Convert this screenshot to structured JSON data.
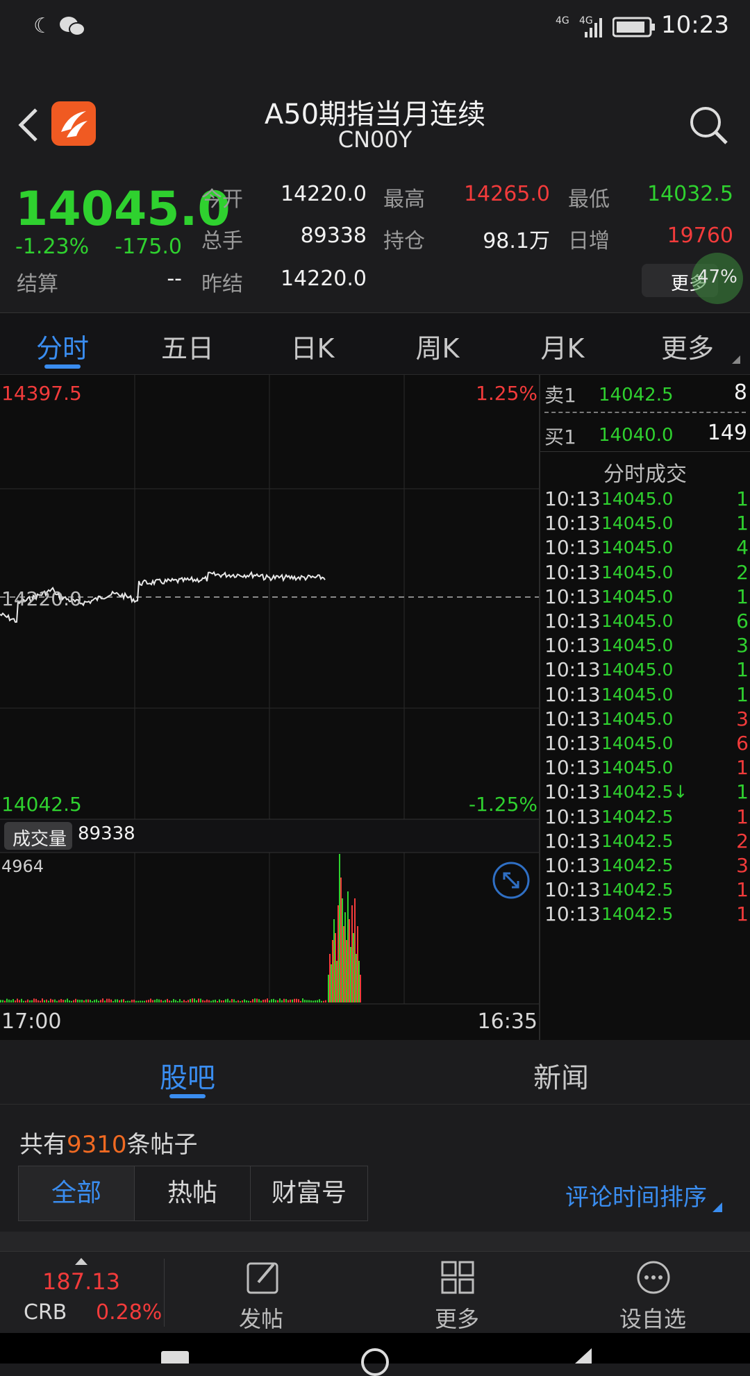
{
  "status": {
    "time": "10:23",
    "net1": "4G",
    "net2": "4G"
  },
  "header": {
    "title": "A50期指当月连续",
    "code": "CN00Y"
  },
  "quote": {
    "price": "14045.0",
    "change_pct": "-1.23%",
    "change": "-175.0",
    "settle_label": "结算",
    "settle_value": "--",
    "open_label": "今开",
    "open_value": "14220.0",
    "high_label": "最高",
    "high_value": "14265.0",
    "low_label": "最低",
    "low_value": "14032.5",
    "volume_label": "总手",
    "volume_value": "89338",
    "oi_label": "持仓",
    "oi_value": "98.1万",
    "oi_change_label": "日增",
    "oi_change_value": "19760",
    "prev_settle_label": "昨结",
    "prev_settle_value": "14220.0",
    "more_label": "更多",
    "badge": "47%"
  },
  "tabs": [
    "分时",
    "五日",
    "日K",
    "周K",
    "月K",
    "更多"
  ],
  "chart": {
    "top_price": "14397.5",
    "top_pct": "1.25%",
    "mid_price": "14220.0",
    "bottom_price": "14042.5",
    "bottom_pct": "-1.25%",
    "volume_label": "成交量",
    "volume_value": "89338",
    "volume_max": "4964",
    "time_start": "17:00",
    "time_end": "16:35",
    "line_color": "#e8e8e8",
    "up_color": "#f23b3b",
    "down_color": "#2fd12f"
  },
  "book": {
    "sell_label": "卖1",
    "sell_price": "14042.5",
    "sell_qty": "8",
    "buy_label": "买1",
    "buy_price": "14040.0",
    "buy_qty": "149",
    "trades_title": "分时成交",
    "trades": [
      {
        "time": "10:13",
        "price": "14045.0",
        "qty": "1",
        "dir": "green"
      },
      {
        "time": "10:13",
        "price": "14045.0",
        "qty": "1",
        "dir": "green"
      },
      {
        "time": "10:13",
        "price": "14045.0",
        "qty": "4",
        "dir": "green"
      },
      {
        "time": "10:13",
        "price": "14045.0",
        "qty": "2",
        "dir": "green"
      },
      {
        "time": "10:13",
        "price": "14045.0",
        "qty": "1",
        "dir": "green"
      },
      {
        "time": "10:13",
        "price": "14045.0",
        "qty": "6",
        "dir": "green"
      },
      {
        "time": "10:13",
        "price": "14045.0",
        "qty": "3",
        "dir": "green"
      },
      {
        "time": "10:13",
        "price": "14045.0",
        "qty": "1",
        "dir": "green"
      },
      {
        "time": "10:13",
        "price": "14045.0",
        "qty": "1",
        "dir": "green"
      },
      {
        "time": "10:13",
        "price": "14045.0",
        "qty": "3",
        "dir": "red"
      },
      {
        "time": "10:13",
        "price": "14045.0",
        "qty": "6",
        "dir": "red"
      },
      {
        "time": "10:13",
        "price": "14045.0",
        "qty": "1",
        "dir": "red"
      },
      {
        "time": "10:13",
        "price": "14042.5↓",
        "qty": "1",
        "dir": "green"
      },
      {
        "time": "10:13",
        "price": "14042.5",
        "qty": "1",
        "dir": "red"
      },
      {
        "time": "10:13",
        "price": "14042.5",
        "qty": "2",
        "dir": "red"
      },
      {
        "time": "10:13",
        "price": "14042.5",
        "qty": "3",
        "dir": "red"
      },
      {
        "time": "10:13",
        "price": "14042.5",
        "qty": "1",
        "dir": "red"
      },
      {
        "time": "10:13",
        "price": "14042.5",
        "qty": "1",
        "dir": "red"
      }
    ]
  },
  "subtabs": {
    "guba": "股吧",
    "news": "新闻"
  },
  "posts": {
    "prefix": "共有",
    "count": "9310",
    "suffix": "条帖子",
    "filters": [
      "全部",
      "热帖",
      "财富号"
    ],
    "sort_label": "评论时间排序"
  },
  "bottomnav": {
    "index_value": "187.13",
    "index_name": "CRB",
    "index_pct": "0.28%",
    "post": "发帖",
    "more": "更多",
    "watch": "设自选"
  }
}
